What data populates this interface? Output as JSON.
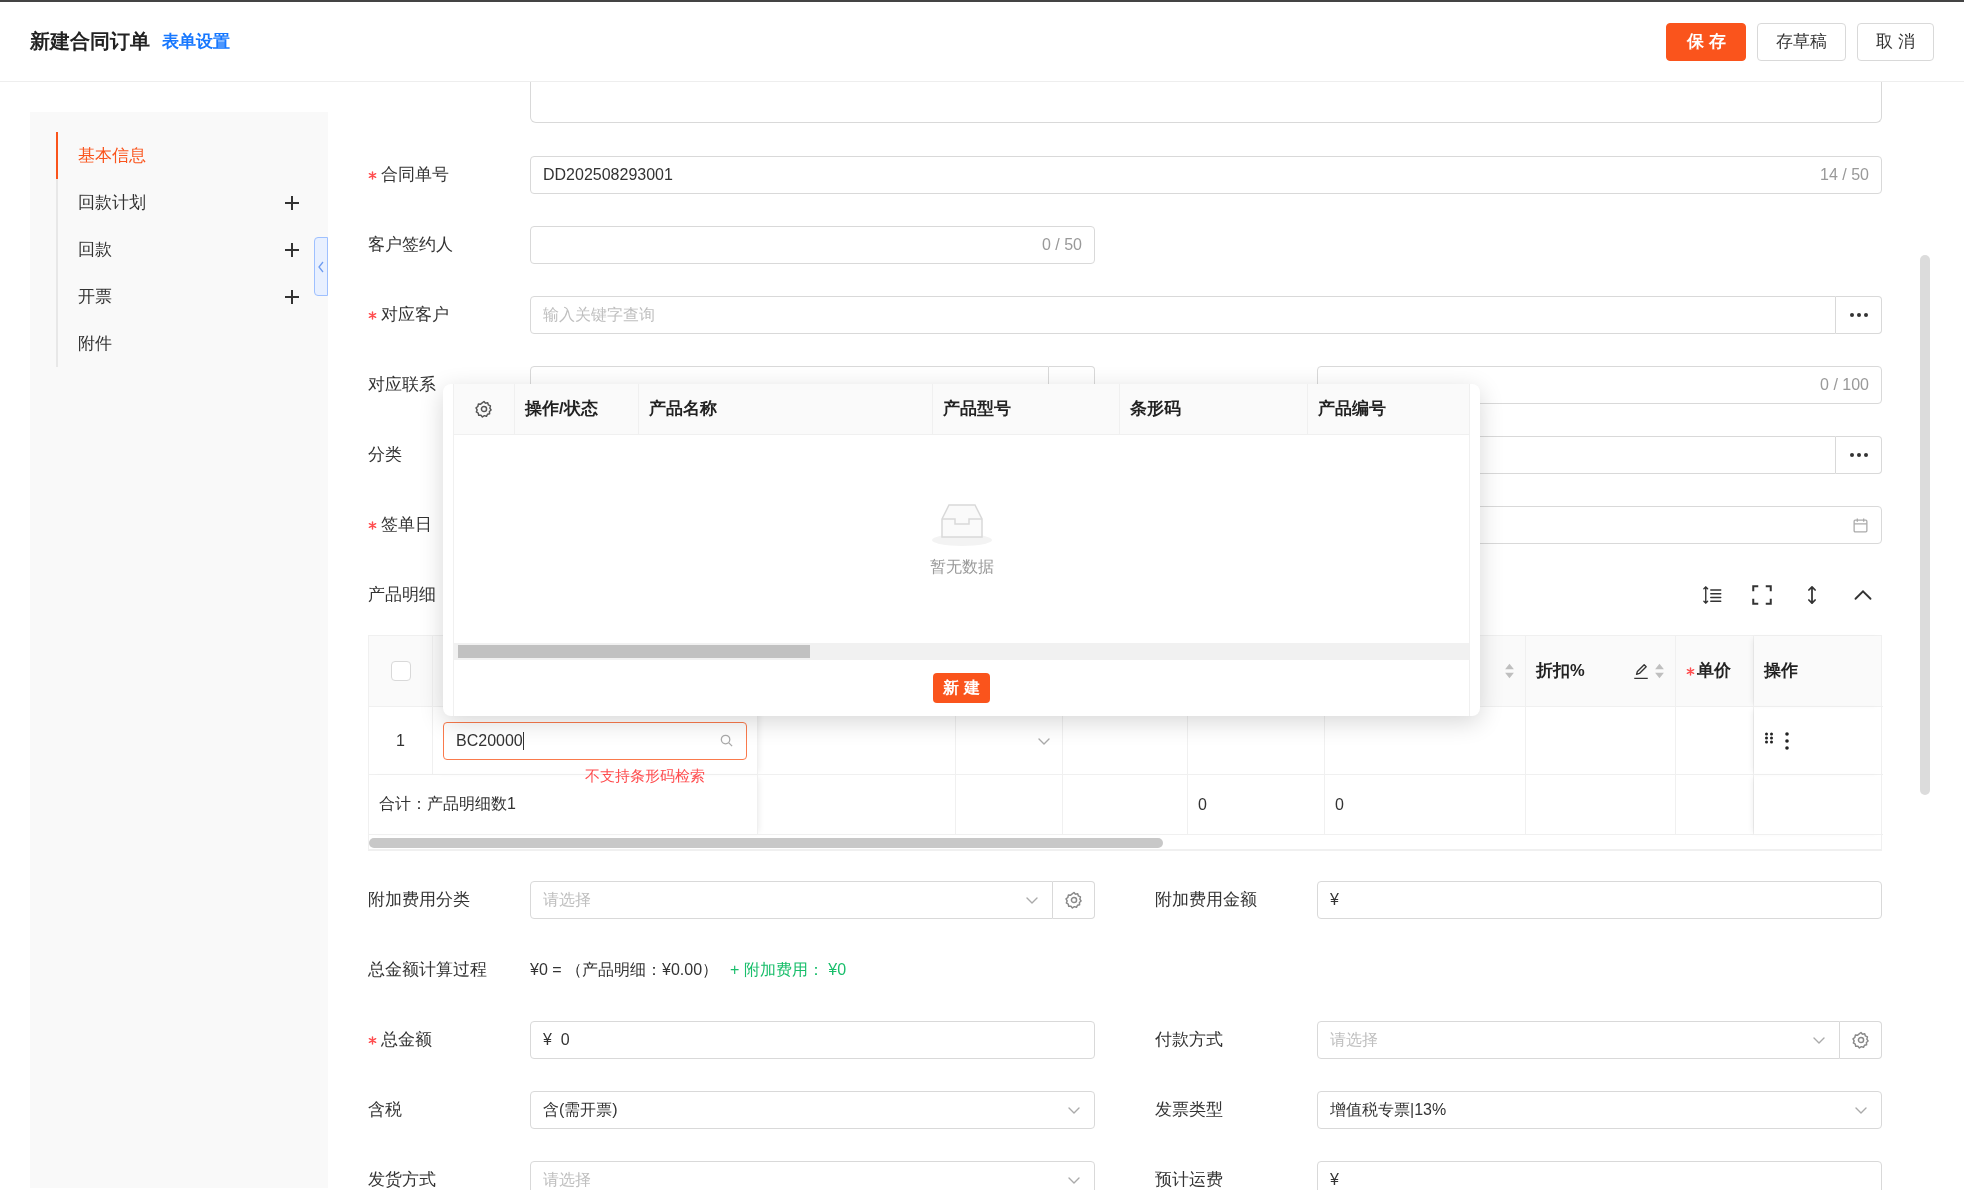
{
  "header": {
    "title": "新建合同订单",
    "link": "表单设置",
    "buttons": [
      {
        "label": "保 存",
        "kind": "primary"
      },
      {
        "label": "存草稿",
        "kind": "default"
      },
      {
        "label": "取 消",
        "kind": "default"
      }
    ]
  },
  "sidebar": {
    "items": [
      {
        "label": "基本信息",
        "selected": true,
        "addable": false
      },
      {
        "label": "回款计划",
        "selected": false,
        "addable": true
      },
      {
        "label": "回款",
        "selected": false,
        "addable": true
      },
      {
        "label": "开票",
        "selected": false,
        "addable": true
      },
      {
        "label": "附件",
        "selected": false,
        "addable": false
      }
    ]
  },
  "form": {
    "contract_no": {
      "label": "合同单号",
      "required": true,
      "value": "DD202508293001",
      "counter": "14 / 50"
    },
    "signer": {
      "label": "客户签约人",
      "required": false,
      "counter": "0 / 50"
    },
    "customer": {
      "label": "对应客户",
      "required": true,
      "placeholder": "输入关键字查询",
      "kind": "more"
    },
    "contact": {
      "label": "对应联系",
      "required": false,
      "kind": "more"
    },
    "contact_info": {
      "counter": "0 / 100"
    },
    "category": {
      "label": "分类",
      "required": false,
      "kind": "more"
    },
    "sign_date": {
      "label": "签单日",
      "required": true,
      "kind": "calendar"
    }
  },
  "product_detail": {
    "title": "产品明细",
    "select_all": {
      "checked": false
    },
    "columns": [
      {
        "label": "折扣%",
        "required": false,
        "editable": true,
        "sortable": true
      },
      {
        "label": "单价",
        "required": true,
        "editable": false,
        "sortable": false
      },
      {
        "label": "操作",
        "required": false,
        "editable": false,
        "sortable": false
      }
    ],
    "rows": [
      {
        "index": "1",
        "barcode": "BC20000",
        "error": "不支持条形码检索"
      }
    ],
    "summary": {
      "label": "合计：产品明细数1",
      "values": [
        "0",
        "0"
      ]
    }
  },
  "popup": {
    "columns": [
      "操作/状态",
      "产品名称",
      "产品型号",
      "条形码",
      "产品编号"
    ],
    "empty_text": "暂无数据",
    "create_button": "新 建"
  },
  "fees": {
    "extra_fee_category": {
      "label": "附加费用分类",
      "required": false,
      "placeholder": "请选择",
      "kind": "gear"
    },
    "extra_fee_amount": {
      "label": "附加费用金额",
      "required": false,
      "value": "¥"
    },
    "calc": {
      "label": "总金额计算过程",
      "formula": "¥0 = （产品明细：¥0.00）",
      "extra": "+ 附加费用： ¥0"
    },
    "total": {
      "label": "总金额",
      "required": true,
      "value": "¥  0"
    },
    "payment": {
      "label": "付款方式",
      "required": false,
      "placeholder": "请选择",
      "kind": "gear"
    },
    "tax": {
      "label": "含税",
      "required": false,
      "value": "含(需开票)",
      "kind": "chevron"
    },
    "invoice_type": {
      "label": "发票类型",
      "required": false,
      "value": "增值税专票|13%",
      "kind": "chevron"
    },
    "shipping": {
      "label": "发货方式",
      "required": false,
      "placeholder": "请选择",
      "kind": "chevron"
    },
    "freight": {
      "label": "预计运费",
      "required": false,
      "value": "¥"
    }
  }
}
